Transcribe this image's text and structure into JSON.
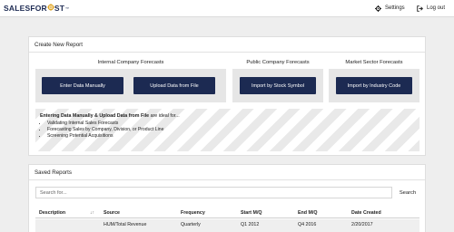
{
  "header": {
    "logo": {
      "part1": "SALES",
      "part2": "FOR",
      "part3": "ST",
      "tm": "™"
    },
    "settings_label": "Settings",
    "logout_label": "Log out"
  },
  "create": {
    "title": "Create New Report",
    "groups": [
      {
        "label": "Internal Company Forecasts",
        "buttons": [
          "Enter Data Manually",
          "Upload Data from File"
        ]
      },
      {
        "label": "Public Company Forecasts",
        "buttons": [
          "Import by Stock Symbol"
        ]
      },
      {
        "label": "Market Sector Forecasts",
        "buttons": [
          "Import by Industry Code"
        ]
      }
    ],
    "info": {
      "intro_bold": "Entering Data Manually & Upload Data from File",
      "intro_rest": " are ideal for...",
      "bullets": [
        "Validating Internal Sales Forecasts",
        "Forecasting Sales by Company, Division, or Product Line",
        "Screening Potential Acquisitions"
      ]
    }
  },
  "saved": {
    "title": "Saved Reports",
    "search_placeholder": "Search for...",
    "search_button": "Search",
    "columns": [
      "Description",
      "Source",
      "Frequency",
      "Start M/Q",
      "End M/Q",
      "Date Created"
    ],
    "rows": [
      [
        "",
        "HUM/Total Revenue",
        "Quarterly",
        "Q1 2012",
        "Q4 2016",
        "2/20/2017"
      ]
    ]
  },
  "colors": {
    "brand_navy": "#1c2a52",
    "logo_accent": "#e0a423"
  }
}
